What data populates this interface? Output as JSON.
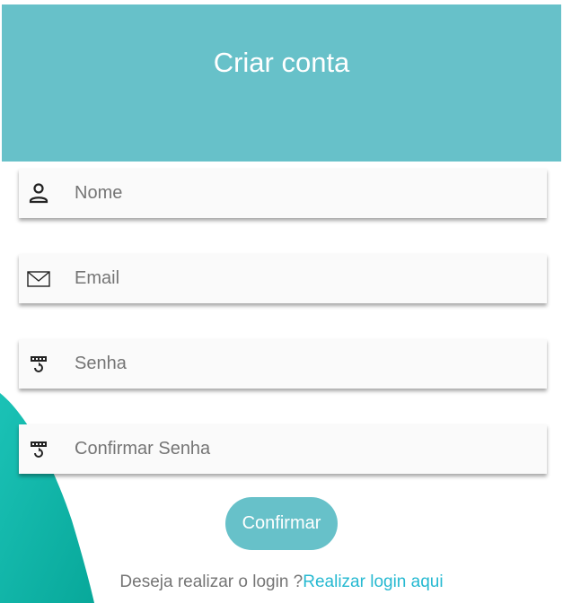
{
  "header": {
    "title": "Criar conta"
  },
  "form": {
    "fields": [
      {
        "placeholder": "Nome",
        "icon": "person-icon"
      },
      {
        "placeholder": "Email",
        "icon": "envelope-icon"
      },
      {
        "placeholder": "Senha",
        "icon": "password-icon"
      },
      {
        "placeholder": "Confirmar Senha",
        "icon": "password-icon"
      }
    ],
    "submit_label": "Confirmar"
  },
  "footer": {
    "prompt": "Deseja realizar o login ?",
    "link_label": "Realizar login aqui"
  },
  "colors": {
    "header_bg": "#67c1c9",
    "button_bg": "#67c1c9",
    "link": "#26b9d1",
    "accent_blob": "#13b9aa"
  }
}
